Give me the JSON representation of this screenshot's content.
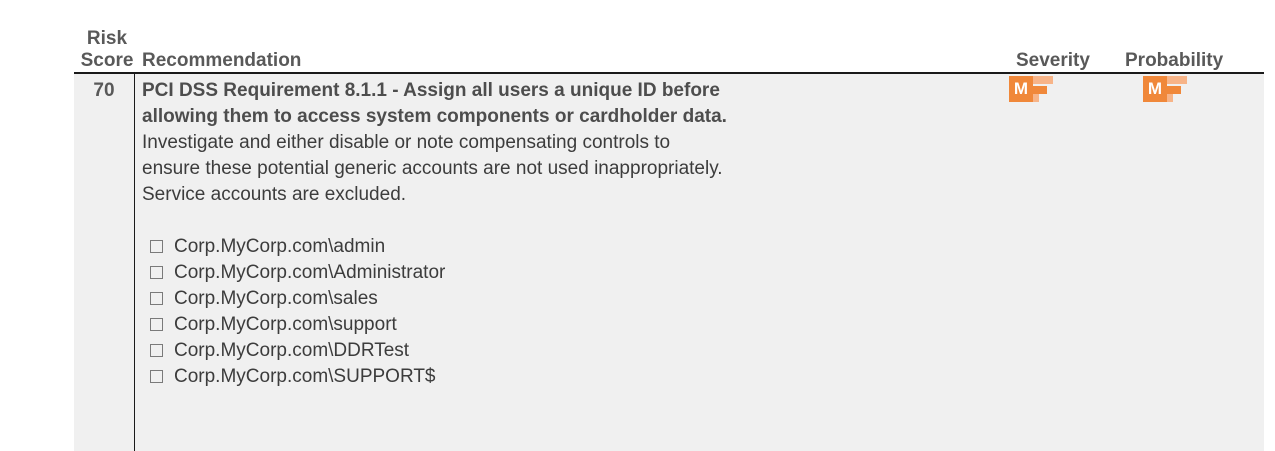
{
  "headers": {
    "risk_score": "Risk\nScore",
    "recommendation": "Recommendation",
    "severity": "Severity",
    "probability": "Probability"
  },
  "row": {
    "score": "70",
    "title": "PCI DSS Requirement 8.1.1 - Assign all users a unique ID before\nallowing them to access system components or cardholder data.",
    "body": "Investigate and either disable or note compensating controls to\nensure these potential generic accounts are not used inappropriately.\n Service accounts are excluded.",
    "accounts": [
      "Corp.MyCorp.com\\admin",
      "Corp.MyCorp.com\\Administrator",
      "Corp.MyCorp.com\\sales",
      "Corp.MyCorp.com\\support",
      "Corp.MyCorp.com\\DDRTest",
      "Corp.MyCorp.com\\SUPPORT$"
    ],
    "severity_badge": "M",
    "probability_badge": "M"
  },
  "colors": {
    "badge_main": "#f0883a",
    "badge_light": "#f7b488",
    "row_background": "#f0f0f0"
  },
  "icons": {
    "checkbox": "checkbox-icon",
    "badge": "medium-level-icon"
  }
}
